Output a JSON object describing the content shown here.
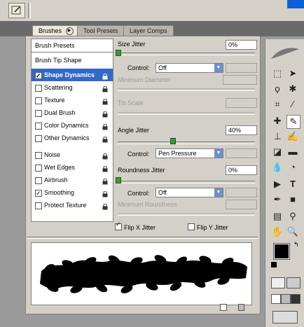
{
  "tabs": [
    "Brushes",
    "Tool Presets",
    "Layer Comps"
  ],
  "list": {
    "header1": "Brush Presets",
    "header2": "Brush Tip Shape",
    "items": [
      {
        "label": "Shape Dynamics",
        "checked": true,
        "selected": true
      },
      {
        "label": "Scattering",
        "checked": false
      },
      {
        "label": "Texture",
        "checked": false
      },
      {
        "label": "Dual Brush",
        "checked": false
      },
      {
        "label": "Color Dynamics",
        "checked": false
      },
      {
        "label": "Other Dynamics",
        "checked": false
      },
      {
        "label": "Noise",
        "checked": false
      },
      {
        "label": "Wet Edges",
        "checked": false
      },
      {
        "label": "Airbrush",
        "checked": false
      },
      {
        "label": "Smoothing",
        "checked": true
      },
      {
        "label": "Protect Texture",
        "checked": false
      }
    ]
  },
  "controls": {
    "size_jitter_label": "Size Jitter",
    "size_jitter_value": "0%",
    "size_jitter_fraction": 0.0,
    "control_label": "Control:",
    "size_control_value": "Off",
    "min_diameter_label": "Minimum Diameter",
    "tilt_scale_label": "Tilt Scale",
    "angle_jitter_label": "Angle Jitter",
    "angle_jitter_value": "40%",
    "angle_jitter_fraction": 0.4,
    "angle_control_value": "Pen Pressure",
    "roundness_jitter_label": "Roundness Jitter",
    "roundness_jitter_value": "0%",
    "roundness_jitter_fraction": 0.0,
    "roundness_control_value": "Off",
    "min_roundness_label": "Minimum Roundness",
    "flip_x_label": "Flip X Jitter",
    "flip_x_checked": true,
    "flip_y_label": "Flip Y Jitter",
    "flip_y_checked": false
  },
  "colors": {
    "highlight": "#3169c6",
    "slider_thumb": "#3b9c2e",
    "window_blue": "#0a5fd8"
  }
}
